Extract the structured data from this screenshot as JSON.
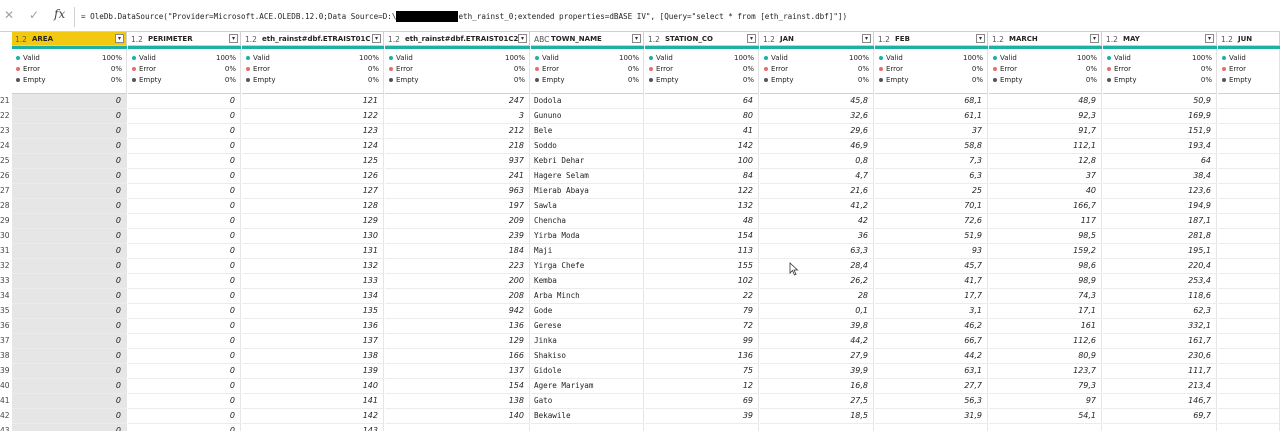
{
  "formula_bar": {
    "cancel_icon": "close-icon",
    "confirm_icon": "check-icon",
    "fx_label": "fx",
    "formula_before": "= OleDb.DataSource(\"Provider=Microsoft.ACE.OLEDB.12.0;Data Source=D:\\",
    "formula_after": "eth_rainst_0;extended properties=dBASE IV\", [Query=\"select * from [eth_rainst.dbf]\"])"
  },
  "columns": [
    {
      "id": "area",
      "type": "1.2",
      "name": "AREA",
      "selected": true,
      "kind": "num"
    },
    {
      "id": "perimeter",
      "type": "1.2",
      "name": "PERIMETER",
      "selected": false,
      "kind": "num"
    },
    {
      "id": "etraist01c",
      "type": "1.2",
      "name": "eth_rainst#dbf.ETRAIST01C",
      "selected": false,
      "kind": "num"
    },
    {
      "id": "etraist01c2",
      "type": "1.2",
      "name": "eth_rainst#dbf.ETRAIST01C2",
      "selected": false,
      "kind": "num"
    },
    {
      "id": "town",
      "type": "ABC",
      "name": "TOWN_NAME",
      "selected": false,
      "kind": "txt"
    },
    {
      "id": "station",
      "type": "1.2",
      "name": "STATION_CO",
      "selected": false,
      "kind": "num"
    },
    {
      "id": "jan",
      "type": "1.2",
      "name": "JAN",
      "selected": false,
      "kind": "num"
    },
    {
      "id": "feb",
      "type": "1.2",
      "name": "FEB",
      "selected": false,
      "kind": "num"
    },
    {
      "id": "march",
      "type": "1.2",
      "name": "MARCH",
      "selected": false,
      "kind": "num"
    },
    {
      "id": "may",
      "type": "1.2",
      "name": "MAY",
      "selected": false,
      "kind": "num"
    },
    {
      "id": "jun",
      "type": "1.2",
      "name": "JUN",
      "selected": false,
      "kind": "num"
    }
  ],
  "quality": {
    "valid_label": "Valid",
    "valid_pct": "100%",
    "valid_color": "#1db0a5",
    "error_label": "Error",
    "error_pct": "0%",
    "error_color": "#e86c6c",
    "empty_label": "Empty",
    "empty_pct": "0%",
    "empty_color": "#555555"
  },
  "row_numbers": [
    "21",
    "22",
    "23",
    "24",
    "25",
    "26",
    "27",
    "28",
    "29",
    "30",
    "31",
    "32",
    "33",
    "34",
    "35",
    "36",
    "37",
    "38",
    "39",
    "40",
    "41",
    "42",
    "43"
  ],
  "rows": [
    [
      "0",
      "0",
      "121",
      "247",
      "Dodola",
      "64",
      "45,8",
      "68,1",
      "48,9",
      "50,9",
      ""
    ],
    [
      "0",
      "0",
      "122",
      "3",
      "Gununo",
      "80",
      "32,6",
      "61,1",
      "92,3",
      "169,9",
      ""
    ],
    [
      "0",
      "0",
      "123",
      "212",
      "Bele",
      "41",
      "29,6",
      "37",
      "91,7",
      "151,9",
      ""
    ],
    [
      "0",
      "0",
      "124",
      "218",
      "Soddo",
      "142",
      "46,9",
      "58,8",
      "112,1",
      "193,4",
      ""
    ],
    [
      "0",
      "0",
      "125",
      "937",
      "Kebri Dehar",
      "100",
      "0,8",
      "7,3",
      "12,8",
      "64",
      ""
    ],
    [
      "0",
      "0",
      "126",
      "241",
      "Hagere Selam",
      "84",
      "4,7",
      "6,3",
      "37",
      "38,4",
      ""
    ],
    [
      "0",
      "0",
      "127",
      "963",
      "Mierab Abaya",
      "122",
      "21,6",
      "25",
      "40",
      "123,6",
      ""
    ],
    [
      "0",
      "0",
      "128",
      "197",
      "Sawla",
      "132",
      "41,2",
      "70,1",
      "166,7",
      "194,9",
      ""
    ],
    [
      "0",
      "0",
      "129",
      "209",
      "Chencha",
      "48",
      "42",
      "72,6",
      "117",
      "187,1",
      ""
    ],
    [
      "0",
      "0",
      "130",
      "239",
      "Yirba Moda",
      "154",
      "36",
      "51,9",
      "98,5",
      "281,8",
      ""
    ],
    [
      "0",
      "0",
      "131",
      "184",
      "Maji",
      "113",
      "63,3",
      "93",
      "159,2",
      "195,1",
      ""
    ],
    [
      "0",
      "0",
      "132",
      "223",
      "Yirga Chefe",
      "155",
      "28,4",
      "45,7",
      "98,6",
      "220,4",
      ""
    ],
    [
      "0",
      "0",
      "133",
      "200",
      "Kemba",
      "102",
      "26,2",
      "41,7",
      "98,9",
      "253,4",
      ""
    ],
    [
      "0",
      "0",
      "134",
      "208",
      "Arba Minch",
      "22",
      "28",
      "17,7",
      "74,3",
      "118,6",
      ""
    ],
    [
      "0",
      "0",
      "135",
      "942",
      "Gode",
      "79",
      "0,1",
      "3,1",
      "17,1",
      "62,3",
      ""
    ],
    [
      "0",
      "0",
      "136",
      "136",
      "Gerese",
      "72",
      "39,8",
      "46,2",
      "161",
      "332,1",
      ""
    ],
    [
      "0",
      "0",
      "137",
      "129",
      "Jinka",
      "99",
      "44,2",
      "66,7",
      "112,6",
      "161,7",
      ""
    ],
    [
      "0",
      "0",
      "138",
      "166",
      "Shakiso",
      "136",
      "27,9",
      "44,2",
      "80,9",
      "230,6",
      ""
    ],
    [
      "0",
      "0",
      "139",
      "137",
      "Gidole",
      "75",
      "39,9",
      "63,1",
      "123,7",
      "111,7",
      ""
    ],
    [
      "0",
      "0",
      "140",
      "154",
      "Agere Mariyam",
      "12",
      "16,8",
      "27,7",
      "79,3",
      "213,4",
      ""
    ],
    [
      "0",
      "0",
      "141",
      "138",
      "Gato",
      "69",
      "27,5",
      "56,3",
      "97",
      "146,7",
      ""
    ],
    [
      "0",
      "0",
      "142",
      "140",
      "Bekawile",
      "39",
      "18,5",
      "31,9",
      "54,1",
      "69,7",
      ""
    ],
    [
      "0",
      "0",
      "143",
      "",
      "",
      "",
      "",
      "",
      "",
      "",
      ""
    ]
  ]
}
